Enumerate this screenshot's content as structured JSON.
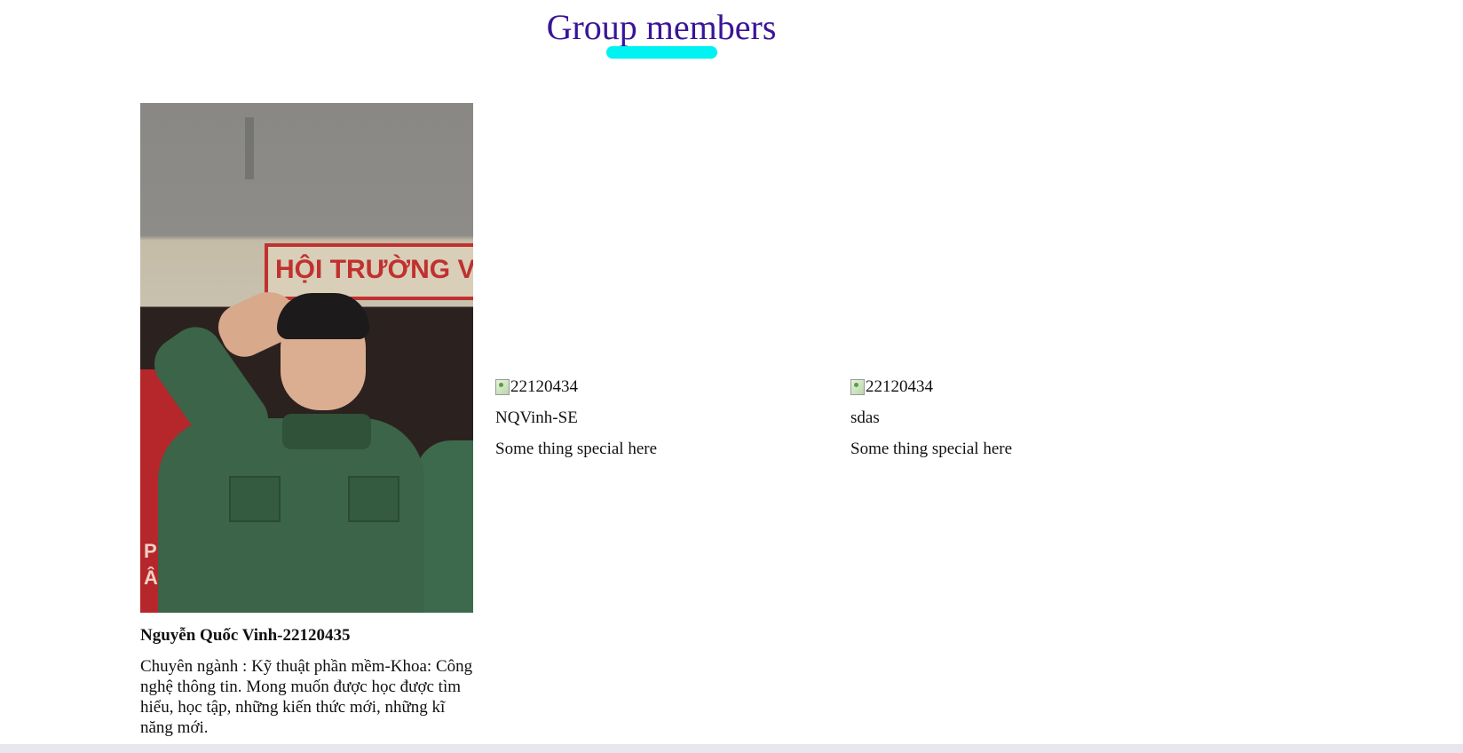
{
  "section": {
    "title": "Group members"
  },
  "members": [
    {
      "photo_alt": "",
      "name": "Nguyễn Quốc Vinh-22120435",
      "description": "Chuyên ngành : Kỹ thuật phần mềm-Khoa: Công nghệ thông tin. Mong muốn được học được tìm hiểu, học tập, những kiến thức mới, những kĩ năng mới.",
      "photo_banner_text": "HỘI TRƯỜNG V",
      "photo_panel_text": "P\nÂN SỰ"
    },
    {
      "photo_alt": "22120434",
      "name": "NQVinh-SE",
      "description": "Some thing special here"
    },
    {
      "photo_alt": "22120434",
      "name": "sdas",
      "description": "Some thing special here"
    }
  ],
  "colors": {
    "heading": "#3a1499",
    "underline": "#00f2f2"
  }
}
